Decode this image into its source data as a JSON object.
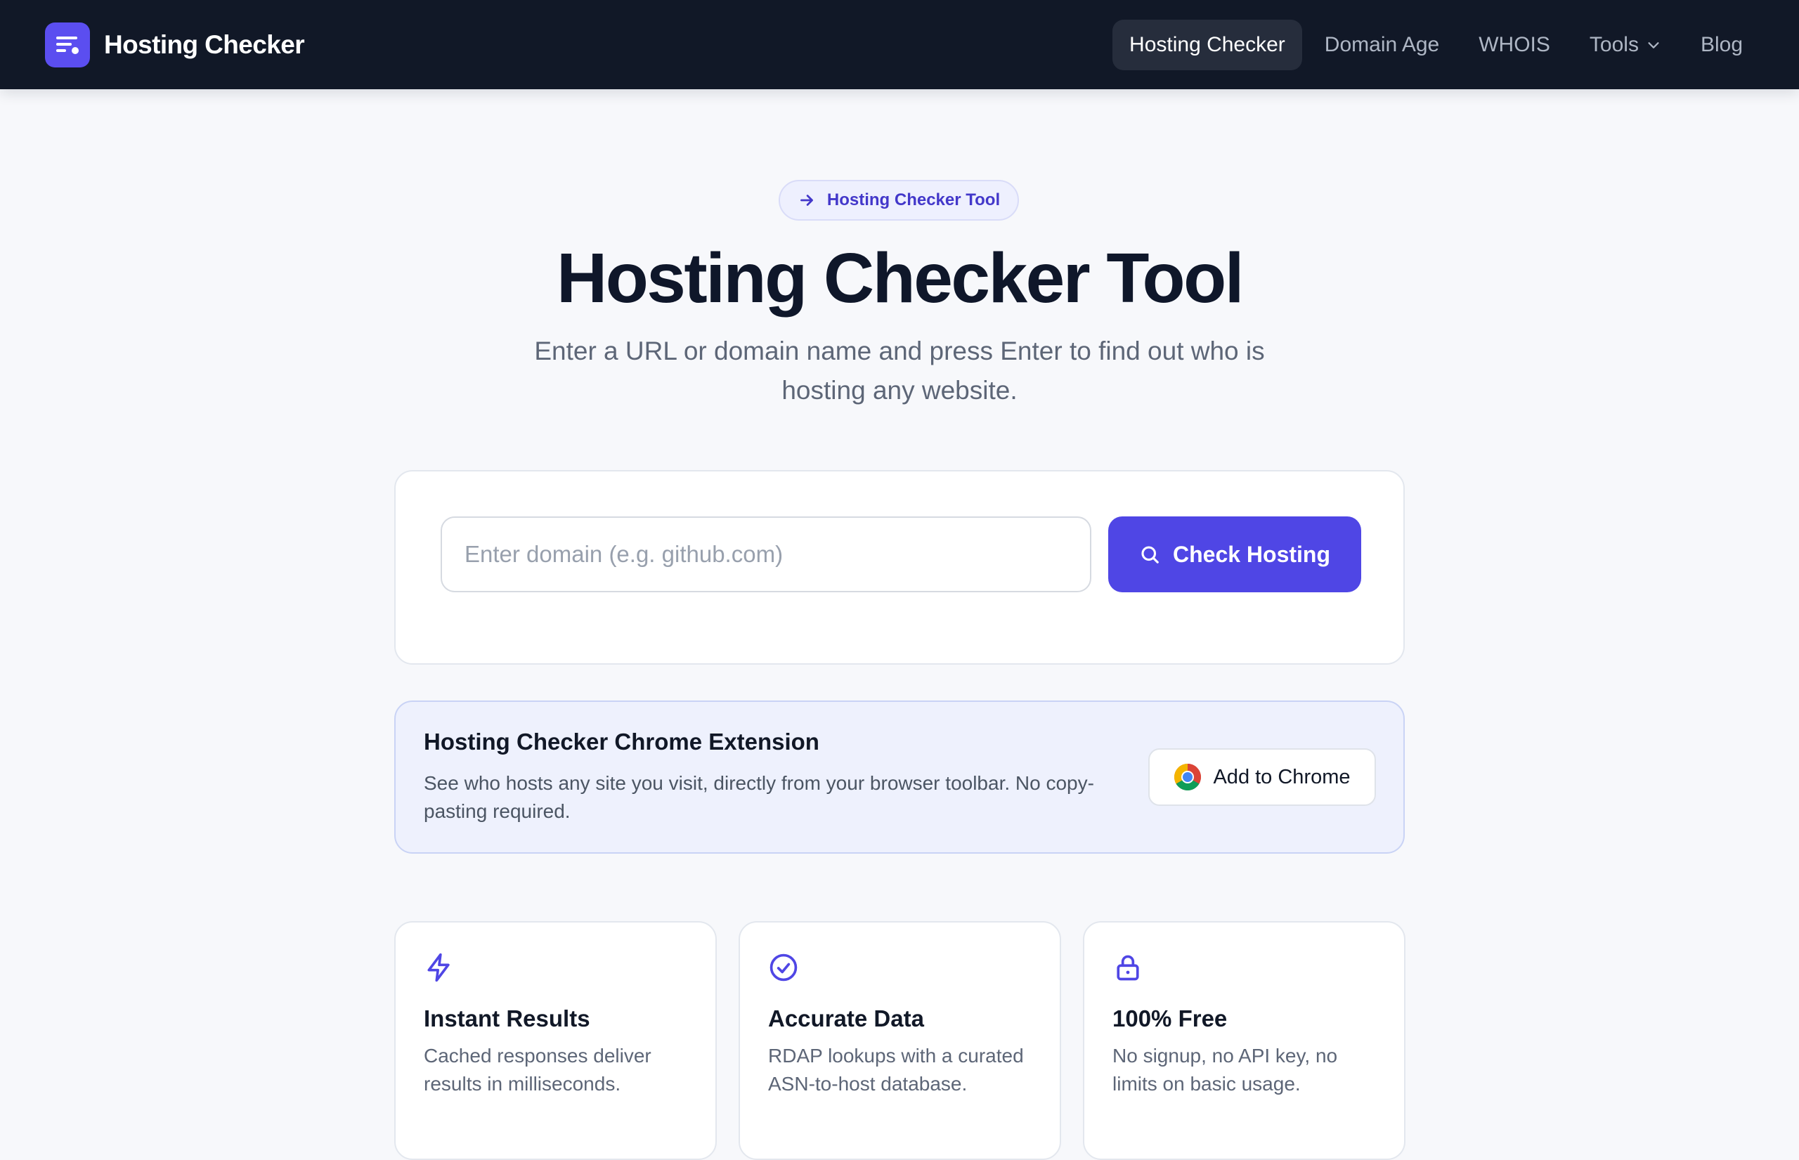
{
  "navbar": {
    "brand_name": "Hosting Checker",
    "items": [
      {
        "label": "Hosting Checker",
        "active": true
      },
      {
        "label": "Domain Age",
        "active": false
      },
      {
        "label": "WHOIS",
        "active": false
      },
      {
        "label": "Tools",
        "active": false,
        "has_dropdown": true
      },
      {
        "label": "Blog",
        "active": false
      }
    ]
  },
  "hero": {
    "badge_label": "Hosting Checker Tool",
    "title": "Hosting Checker Tool",
    "subtitle": "Enter a URL or domain name and press Enter to find out who is hosting any website."
  },
  "search": {
    "placeholder": "Enter domain (e.g. github.com)",
    "value": "",
    "button_label": "Check Hosting"
  },
  "extension": {
    "title": "Hosting Checker Chrome Extension",
    "description": "See who hosts any site you visit, directly from your browser toolbar. No copy-pasting required.",
    "button_label": "Add to Chrome"
  },
  "features": [
    {
      "icon": "lightning-icon",
      "title": "Instant Results",
      "description": "Cached responses deliver results in milliseconds."
    },
    {
      "icon": "check-circle-icon",
      "title": "Accurate Data",
      "description": "RDAP lookups with a curated ASN-to-host database."
    },
    {
      "icon": "lock-icon",
      "title": "100% Free",
      "description": "No signup, no API key, no limits on basic usage."
    }
  ],
  "colors": {
    "navbar_bg": "#111827",
    "accent": "#4f46e5",
    "page_bg": "#f7f8fb",
    "extension_bg": "#eef1fd"
  }
}
